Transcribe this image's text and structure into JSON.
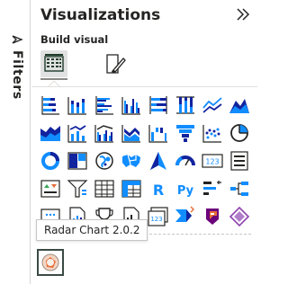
{
  "filters_rail": {
    "label": "Filters",
    "toggle_icon": "pane-toggle-icon"
  },
  "visualizations": {
    "title": "Visualizations",
    "subtitle": "Build visual",
    "collapse_icon": "double-chevron-right-icon",
    "modes": [
      {
        "name": "build-visual",
        "icon": "table-grid-icon",
        "selected": true
      },
      {
        "name": "format-visual",
        "icon": "paintbrush-icon",
        "selected": false
      }
    ],
    "grid_icons": [
      "stacked-bar-chart-icon",
      "stacked-column-chart-icon",
      "clustered-bar-chart-icon",
      "clustered-column-chart-icon",
      "100-stacked-bar-chart-icon",
      "100-stacked-column-chart-icon",
      "line-chart-icon",
      "area-chart-icon",
      "stacked-area-chart-icon",
      "line-stacked-column-chart-icon",
      "line-clustered-column-chart-icon",
      "ribbon-chart-icon",
      "waterfall-chart-icon",
      "funnel-chart-icon",
      "scatter-chart-icon",
      "pie-chart-icon",
      "donut-chart-icon",
      "treemap-icon",
      "map-icon",
      "filled-map-icon",
      "azure-map-icon",
      "gauge-icon",
      "card-icon",
      "multi-row-card-icon",
      "kpi-icon",
      "slicer-icon",
      "table-icon",
      "matrix-icon",
      "r-script-visual-icon",
      "python-visual-icon",
      "key-influencers-icon",
      "decomposition-tree-icon",
      "qa-visual-icon",
      "paginated-report-icon",
      "goals-icon",
      "smart-narrative-icon",
      "new-card-icon",
      "power-automate-icon",
      "power-apps-icon",
      "more-visuals-icon"
    ],
    "custom_visual": {
      "icon": "radar-chart-icon",
      "tooltip": "Radar Chart 2.0.2"
    }
  },
  "colors": {
    "blue": "#118dff",
    "navy": "#12239e",
    "orange": "#e66c37",
    "purple": "#6b007b",
    "gray": "#605e5c"
  }
}
